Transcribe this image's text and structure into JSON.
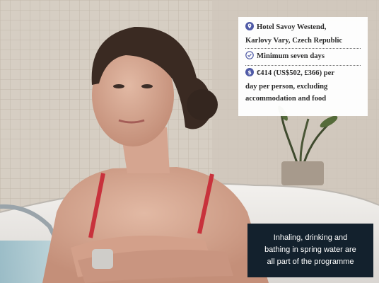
{
  "info": {
    "location_line1": "Hotel Savoy Westend,",
    "location_line2": "Karlovy Vary, Czech Republic",
    "duration": "Minimum seven days",
    "price_line1": "€414 (US$502, £366) per",
    "price_line2": "day per person, excluding",
    "price_line3": "accommodation and food",
    "icon_color": "#4f5aa6"
  },
  "caption": {
    "line1": "Inhaling, drinking and",
    "line2": "bathing in spring water are",
    "line3": "all part of the programme"
  },
  "colors": {
    "caption_bg": "#13212d",
    "swimsuit": "#c8323c"
  }
}
